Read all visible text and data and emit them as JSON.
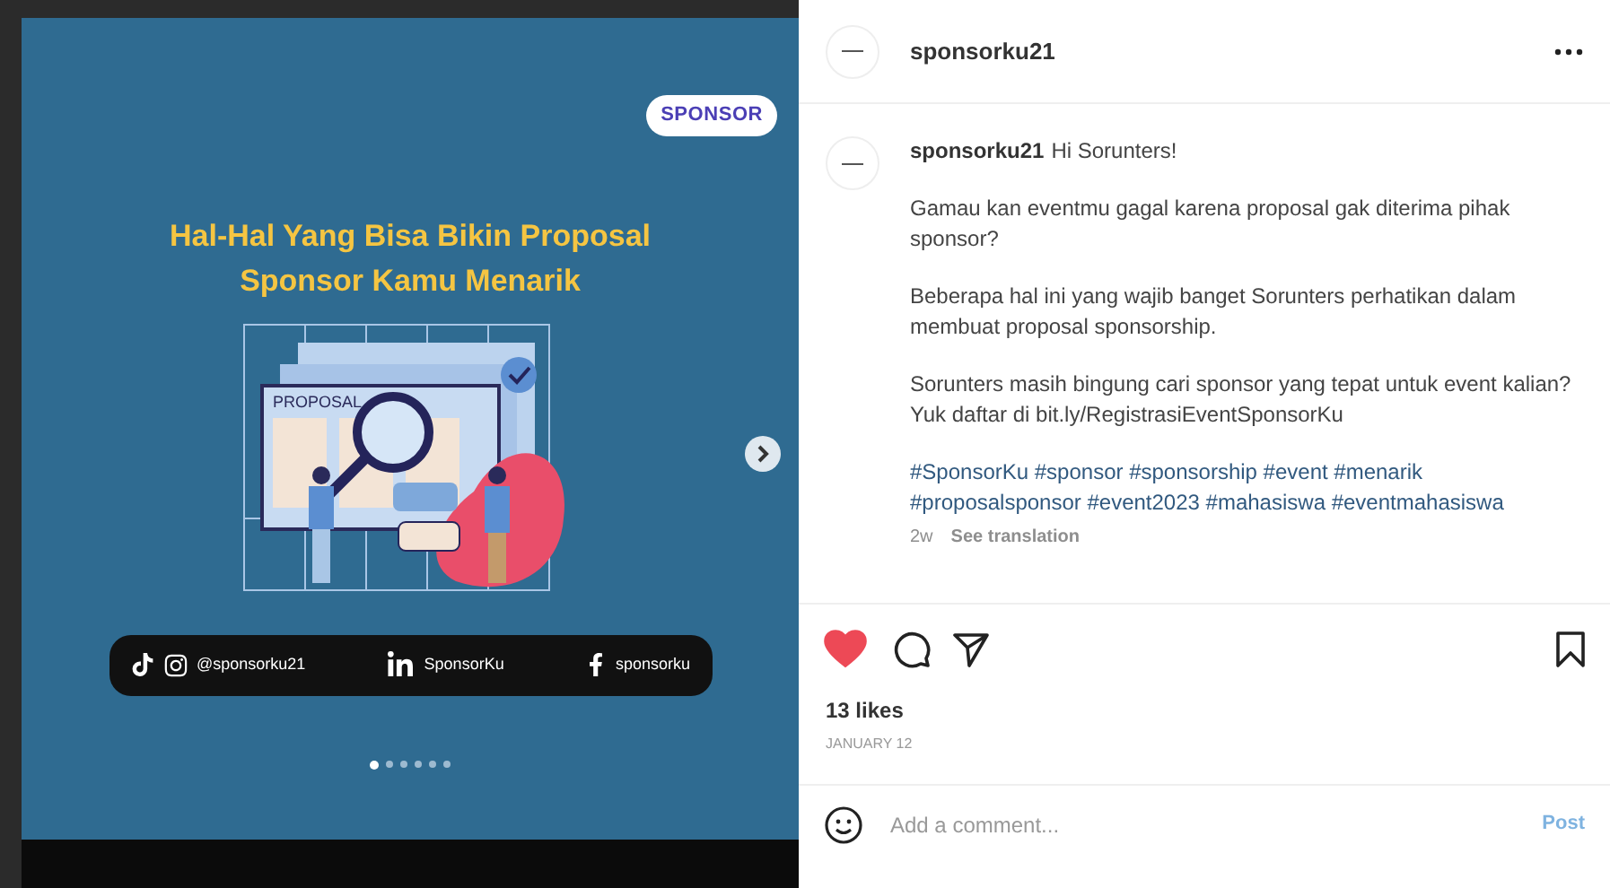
{
  "post_image": {
    "logo": "SPONSOR",
    "title": "Hal-Hal Yang Bisa Bikin Proposal Sponsor Kamu Menarik",
    "illustration_label": "PROPOSAL",
    "socials": [
      {
        "kind": "tiktok_instagram",
        "handle": "@sponsorku21"
      },
      {
        "kind": "linkedin",
        "handle": "SponsorKu"
      },
      {
        "kind": "facebook",
        "handle": "sponsorku"
      }
    ],
    "slides": [
      {
        "selected": true
      },
      {
        "selected": false
      },
      {
        "selected": false
      },
      {
        "selected": false
      },
      {
        "selected": false
      },
      {
        "selected": false
      }
    ]
  },
  "header": {
    "username": "sponsorku21"
  },
  "caption": {
    "username": "sponsorku21",
    "greeting": "Hi Sorunters!",
    "paragraphs": [
      "Gamau kan eventmu gagal karena proposal gak diterima pihak sponsor?",
      "Beberapa hal ini yang wajib banget Sorunters perhatikan dalam membuat proposal sponsorship.",
      "Sorunters masih bingung cari sponsor yang tepat untuk event kalian? Yuk daftar di bit.ly/RegistrasiEventSponsorKu"
    ],
    "hashtags": "#SponsorKu #sponsor #sponsorship #event #menarik #proposalsponsor #event2023 #mahasiswa #eventmahasiswa",
    "age": "2w",
    "translate": "See translation"
  },
  "actions": {
    "liked": true
  },
  "likes": "13 likes",
  "date": "JANUARY 12",
  "comment": {
    "placeholder": "Add a comment...",
    "post": "Post"
  }
}
